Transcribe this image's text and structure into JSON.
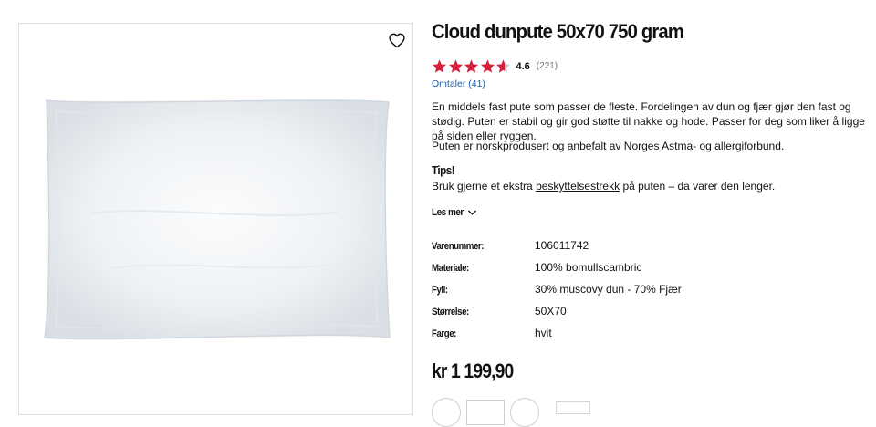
{
  "product": {
    "title": "Cloud dunpute 50x70 750 gram",
    "rating": "4.6",
    "rating_fraction": 0.92,
    "rating_count": "(221)",
    "reviews_link": "Omtaler (41)",
    "description_1": "En middels fast pute som passer de fleste. Fordelingen av dun og fjær gjør den fast og stødig. Puten er stabil og gir god støtte til nakke og hode. Passer for deg som liker å ligge på siden eller ryggen.",
    "description_2": "Puten er norskprodusert og anbefalt av Norges Astma- og allergiforbund.",
    "tips_title": "Tips!",
    "tips_before": "Bruk gjerne et ekstra ",
    "tips_link": "beskyttelsestrekk",
    "tips_after": " på puten – da varer den lenger.",
    "read_more": "Les mer",
    "price": "kr 1 199,90"
  },
  "specs": [
    {
      "label": "Varenummer:",
      "value": "106011742"
    },
    {
      "label": "Materiale:",
      "value": "100% bomullscambric"
    },
    {
      "label": "Fyll:",
      "value": "30% muscovy dun - 70% Fjær"
    },
    {
      "label": "Størrelse:",
      "value": "50X70"
    },
    {
      "label": "Farge:",
      "value": "hvit"
    }
  ],
  "icons": {
    "favorite": "heart-outline-icon",
    "star": "star-icon",
    "read_more": "chevron-down-icon"
  },
  "colors": {
    "star_fill": "#d6203c",
    "star_empty": "#c8c8c8",
    "link": "#1c5fa8"
  }
}
